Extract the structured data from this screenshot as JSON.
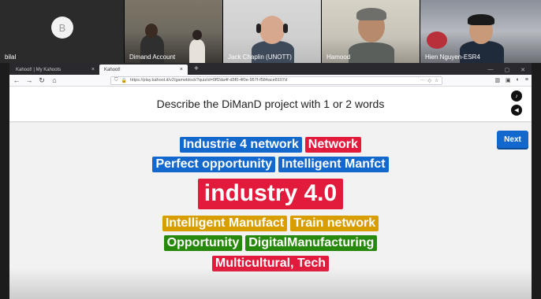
{
  "video_call": {
    "participants": [
      {
        "name": "bilal",
        "initial": "B"
      },
      {
        "name": "Dimand Account"
      },
      {
        "name": "Jack Chaplin (UNOTT)"
      },
      {
        "name": "Hamood"
      },
      {
        "name": "Hien Nguyen-ESR4"
      }
    ]
  },
  "browser": {
    "tabs": [
      {
        "label": "Kahoot! | My Kahoots",
        "close": "×"
      },
      {
        "label": "Kahoot!",
        "close": "×"
      }
    ],
    "new_tab": "+",
    "url": "https://play.kahoot.it/v2/gameblock?quizId=0ff2da4f-d5f0-4f0e-957f-f584ace8107d",
    "url_menu": "···"
  },
  "kahoot": {
    "question": "Describe the DiManD project with 1 or 2 words",
    "next_label": "Next",
    "words": [
      {
        "text": "Industrie 4 network",
        "color": "#1368ce"
      },
      {
        "text": "Network",
        "color": "#e21b3c"
      },
      {
        "text": "Perfect opportunity",
        "color": "#1368ce"
      },
      {
        "text": "Intelligent Manfct",
        "color": "#1368ce"
      },
      {
        "text": "industry 4.0",
        "color": "#e21b3c"
      },
      {
        "text": "Intelligent Manufact",
        "color": "#d89e00"
      },
      {
        "text": "Train network",
        "color": "#d89e00"
      },
      {
        "text": "Opportunity",
        "color": "#26890c"
      },
      {
        "text": "DigitalManufacturing",
        "color": "#26890c"
      },
      {
        "text": "Multicultural, Tech",
        "color": "#e21b3c"
      }
    ]
  }
}
